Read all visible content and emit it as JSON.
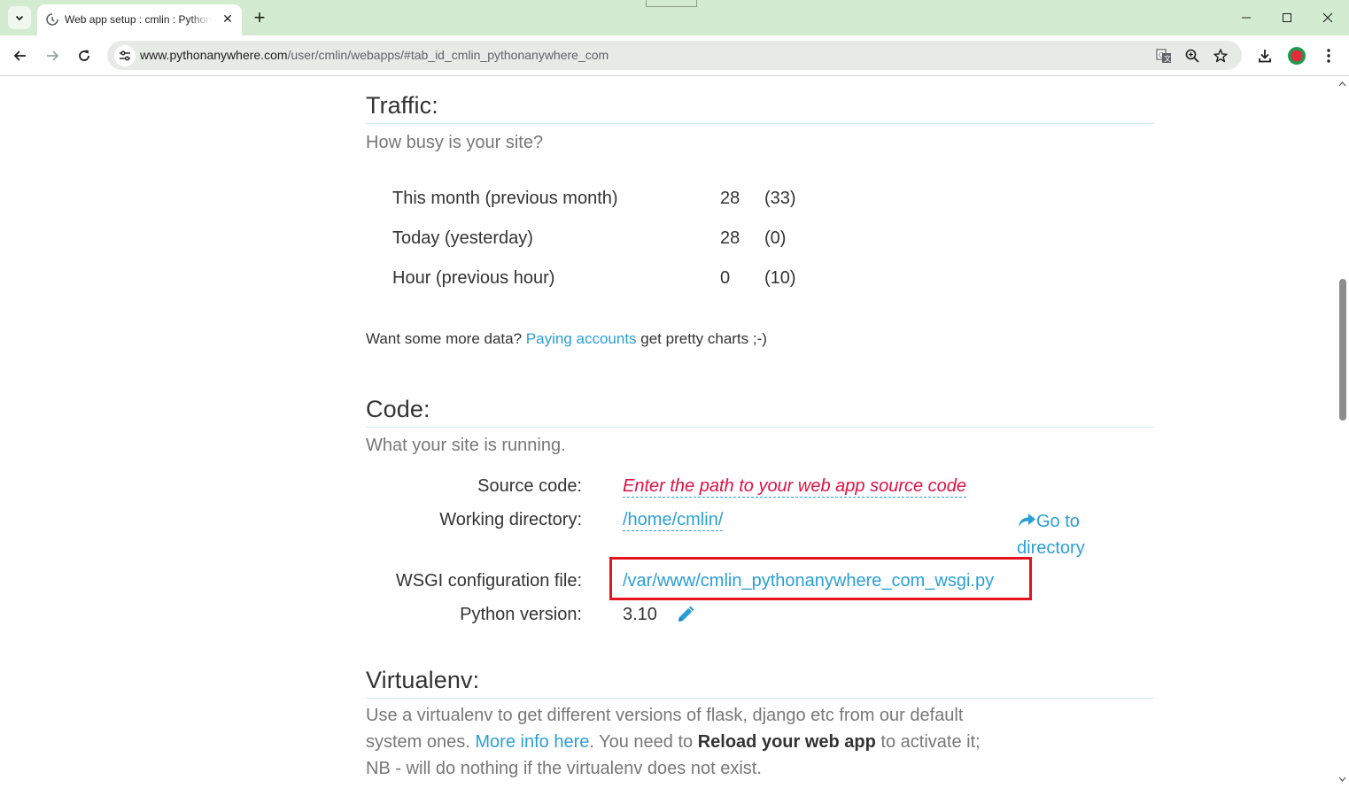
{
  "browser": {
    "tab_title": "Web app setup : cmlin : PythonAnywhere",
    "url_host": "www.pythonanywhere.com",
    "url_path": "/user/cmlin/webapps/#tab_id_cmlin_pythonanywhere_com"
  },
  "traffic": {
    "heading": "Traffic:",
    "subheading": "How busy is your site?",
    "rows": [
      {
        "label": "This month (previous month)",
        "value": "28",
        "previous": "(33)"
      },
      {
        "label": "Today (yesterday)",
        "value": "28",
        "previous": "(0)"
      },
      {
        "label": "Hour (previous hour)",
        "value": "0",
        "previous": "(10)"
      }
    ],
    "more_data_prefix": "Want some more data? ",
    "more_data_link": "Paying accounts",
    "more_data_suffix": " get pretty charts ;-)"
  },
  "code": {
    "heading": "Code:",
    "subheading": "What your site is running.",
    "source_label": "Source code:",
    "source_placeholder": "Enter the path to your web app source code",
    "working_dir_label": "Working directory:",
    "working_dir_value": "/home/cmlin/",
    "go_to_directory": "Go to directory",
    "wsgi_label": "WSGI configuration file:",
    "wsgi_value": "/var/www/cmlin_pythonanywhere_com_wsgi.py",
    "python_label": "Python version:",
    "python_value": "3.10"
  },
  "virtualenv": {
    "heading": "Virtualenv:",
    "text_1": "Use a virtualenv to get different versions of flask, django etc from our default system ones. ",
    "more_info_link": "More info here",
    "text_2": ". You need to ",
    "reload_bold": "Reload your web app",
    "text_3": " to activate it; NB - will do nothing if the virtualenv does not exist."
  },
  "colors": {
    "tabstrip": "#d3ecd1",
    "link": "#2a9fd6",
    "placeholder": "#dd1144",
    "highlight_box": "#e3141e"
  },
  "icons": [
    "tab-list-icon",
    "pythonanywhere-favicon-icon",
    "close-icon",
    "plus-icon",
    "minimize-icon",
    "maximize-icon",
    "close-window-icon",
    "back-arrow-icon",
    "forward-arrow-icon",
    "reload-icon",
    "site-info-icon",
    "translate-icon",
    "zoom-icon",
    "star-icon",
    "download-icon",
    "profile-icon",
    "kebab-menu-icon",
    "share-arrow-icon",
    "pencil-icon"
  ]
}
